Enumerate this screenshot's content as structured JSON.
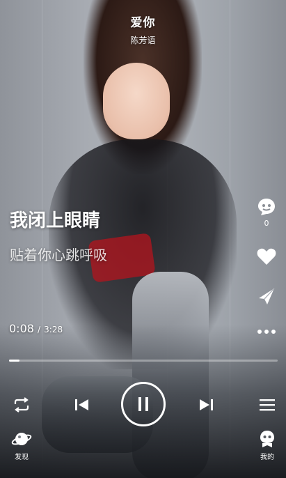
{
  "song": {
    "title": "爱你",
    "artist": "陈芳语"
  },
  "lyrics": {
    "current": "我闭上眼睛",
    "next": "贴着你心跳呼吸"
  },
  "side_actions": {
    "comment_count": "0"
  },
  "player": {
    "current_time": "0:08",
    "separator": "/",
    "total_time": "3:28",
    "progress": 0.04
  },
  "bottom_nav": {
    "discover_label": "发现",
    "mine_label": "我的"
  },
  "icons": [
    "comment-icon",
    "heart-icon",
    "share-icon",
    "more-icon",
    "repeat-icon",
    "previous-icon",
    "pause-icon",
    "next-icon",
    "playlist-icon",
    "discover-icon",
    "profile-icon"
  ]
}
